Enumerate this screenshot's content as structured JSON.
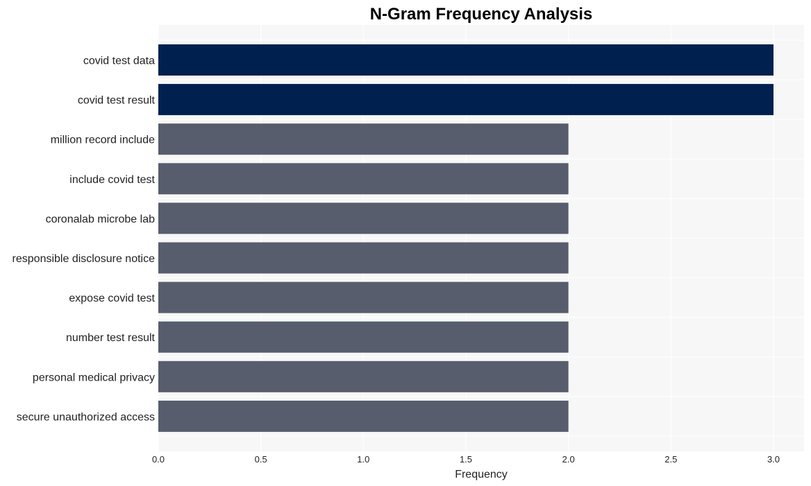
{
  "chart_data": {
    "type": "bar",
    "orientation": "horizontal",
    "title": "N-Gram Frequency Analysis",
    "xlabel": "Frequency",
    "ylabel": "",
    "categories": [
      "covid test data",
      "covid test result",
      "million record include",
      "include covid test",
      "coronalab microbe lab",
      "responsible disclosure notice",
      "expose covid test",
      "number test result",
      "personal medical privacy",
      "secure unauthorized access"
    ],
    "values": [
      3,
      3,
      2,
      2,
      2,
      2,
      2,
      2,
      2,
      2
    ],
    "xlim": [
      0,
      3.15
    ],
    "xticks": [
      0.0,
      0.5,
      1.0,
      1.5,
      2.0,
      2.5,
      3.0
    ],
    "xtick_labels": [
      "0.0",
      "0.5",
      "1.0",
      "1.5",
      "2.0",
      "2.5",
      "3.0"
    ],
    "grid": true,
    "legend": "none",
    "colors": {
      "highlight": "#00204f",
      "default": "#575d6d",
      "plot_background": "#f7f7f7",
      "grid": "#ffffff"
    }
  }
}
